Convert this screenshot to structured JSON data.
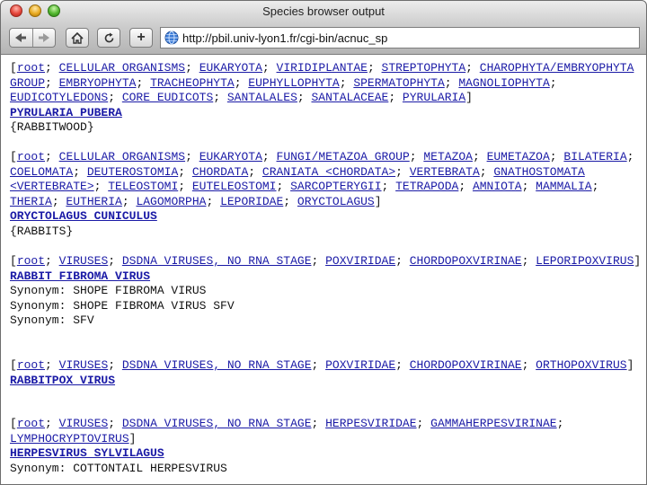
{
  "window": {
    "title": "Species browser output"
  },
  "toolbar": {
    "url": "http://pbil.univ-lyon1.fr/cgi-bin/acnuc_sp",
    "add_label": "+"
  },
  "entries": [
    {
      "lineage": [
        "root",
        "CELLULAR ORGANISMS",
        "EUKARYOTA",
        "VIRIDIPLANTAE",
        "STREPTOPHYTA",
        "CHAROPHYTA/EMBRYOPHYTA GROUP",
        "EMBRYOPHYTA",
        "TRACHEOPHYTA",
        "EUPHYLLOPHYTA",
        "SPERMATOPHYTA",
        "MAGNOLIOPHYTA",
        "EUDICOTYLEDONS",
        "CORE EUDICOTS",
        "SANTALALES",
        "SANTALACEAE",
        "PYRULARIA"
      ],
      "name": "PYRULARIA PUBERA",
      "lines": [
        "{RABBITWOOD}"
      ]
    },
    {
      "lineage": [
        "root",
        "CELLULAR ORGANISMS",
        "EUKARYOTA",
        "FUNGI/METAZOA GROUP",
        "METAZOA",
        "EUMETAZOA",
        "BILATERIA",
        "COELOMATA",
        "DEUTEROSTOMIA",
        "CHORDATA",
        "CRANIATA <CHORDATA>",
        "VERTEBRATA",
        "GNATHOSTOMATA <VERTEBRATE>",
        "TELEOSTOMI",
        "EUTELEOSTOMI",
        "SARCOPTERYGII",
        "TETRAPODA",
        "AMNIOTA",
        "MAMMALIA",
        "THERIA",
        "EUTHERIA",
        "LAGOMORPHA",
        "LEPORIDAE",
        "ORYCTOLAGUS"
      ],
      "name": "ORYCTOLAGUS CUNICULUS",
      "lines": [
        "{RABBITS}"
      ]
    },
    {
      "lineage": [
        "root",
        "VIRUSES",
        "DSDNA VIRUSES, NO RNA STAGE",
        "POXVIRIDAE",
        "CHORDOPOXVIRINAE",
        "LEPORIPOXVIRUS"
      ],
      "name": "RABBIT FIBROMA VIRUS",
      "lines": [
        "Synonym: SHOPE FIBROMA VIRUS",
        "Synonym: SHOPE FIBROMA VIRUS SFV",
        "Synonym: SFV"
      ]
    },
    {
      "lineage": [
        "root",
        "VIRUSES",
        "DSDNA VIRUSES, NO RNA STAGE",
        "POXVIRIDAE",
        "CHORDOPOXVIRINAE",
        "ORTHOPOXVIRUS"
      ],
      "name": "RABBITPOX VIRUS",
      "lines": []
    },
    {
      "lineage": [
        "root",
        "VIRUSES",
        "DSDNA VIRUSES, NO RNA STAGE",
        "HERPESVIRIDAE",
        "GAMMAHERPESVIRINAE",
        "LYMPHOCRYPTOVIRUS"
      ],
      "name": "HERPESVIRUS SYLVILAGUS",
      "lines": [
        "Synonym: COTTONTAIL HERPESVIRUS"
      ]
    }
  ],
  "colors": {
    "link": "#1a1aa6",
    "toolbar": "#c4c4c4"
  },
  "icons": [
    "back-arrow-icon",
    "forward-arrow-icon",
    "home-icon",
    "reload-icon",
    "globe-icon"
  ]
}
